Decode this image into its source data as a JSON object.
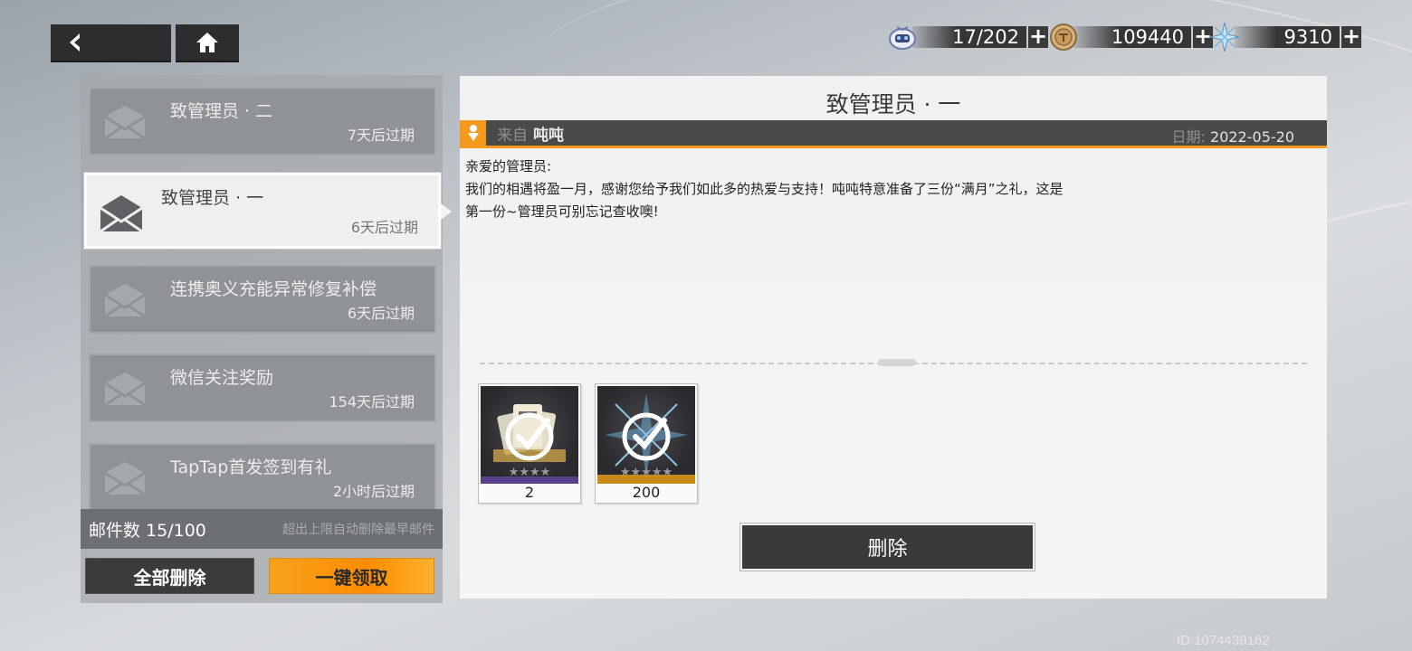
{
  "resources": {
    "stamina": {
      "icon": "stamina-robot-icon",
      "value": "17/202"
    },
    "coins": {
      "icon": "coin-icon",
      "value": "109440"
    },
    "crystals": {
      "icon": "crystal-shard-icon",
      "value": "9310"
    },
    "plus_symbol": "+"
  },
  "mail_list": {
    "items": [
      {
        "title": "致管理员 · 二",
        "expire": "7天后过期"
      },
      {
        "title": "致管理员 · 一",
        "expire": "6天后过期"
      },
      {
        "title": "连携奥义充能异常修复补偿",
        "expire": "6天后过期"
      },
      {
        "title": "微信关注奖励",
        "expire": "154天后过期"
      },
      {
        "title": "TapTap首发签到有礼",
        "expire": "2小时后过期"
      }
    ],
    "selected_index": 1,
    "count_text": "邮件数 15/100",
    "limit_hint": "超出上限自动删除最早邮件",
    "delete_all_label": "全部删除",
    "claim_all_label": "一键领取"
  },
  "mail": {
    "title": "致管理员 · 一",
    "from_label": "来自",
    "sender": "吨吨",
    "date_label": "日期:",
    "date": "2022-05-20",
    "body_lines": [
      "亲爱的管理员:",
      "我们的相遇将盈一月，感谢您给予我们如此多的热爱与支持！吨吨特意准备了三份“满月”之礼，这是",
      "第一份~管理员可别忘记查收噢!"
    ],
    "attachments": [
      {
        "quantity": "2",
        "claimed": true,
        "stars": 4
      },
      {
        "quantity": "200",
        "claimed": true,
        "stars": 5
      }
    ],
    "delete_label": "删除"
  },
  "footer": {
    "id_text": "ID:1074439162"
  },
  "colors": {
    "accent": "#f59a1c",
    "dark": "#3a3a3c",
    "panel": "#f1f1f1"
  }
}
